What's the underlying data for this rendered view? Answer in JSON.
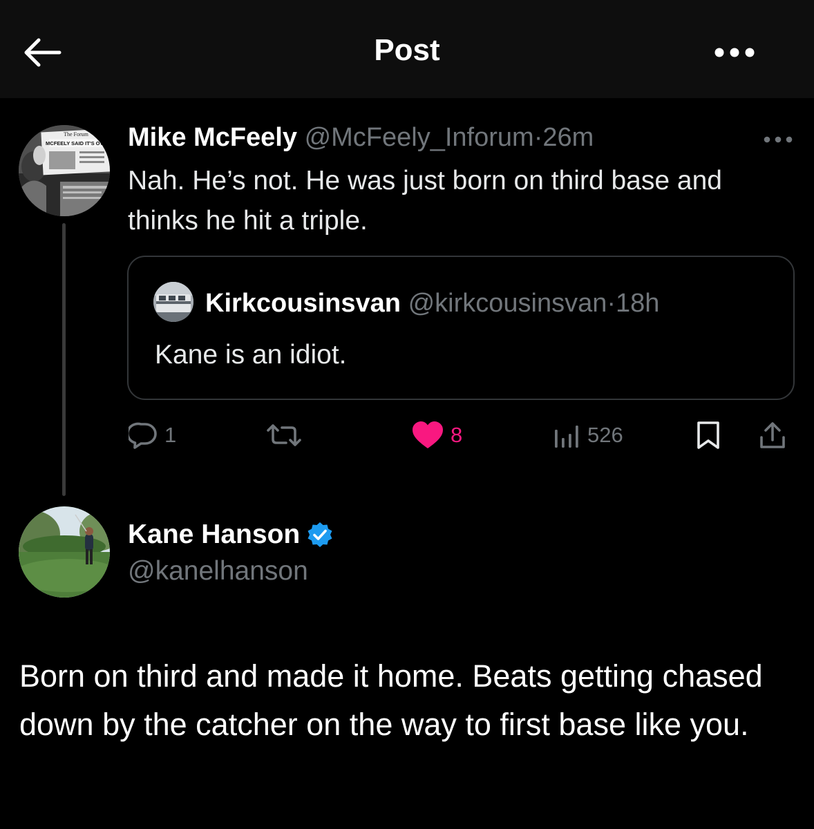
{
  "header": {
    "title": "Post",
    "back_icon": "arrow-left-icon",
    "more_icon": "more-horizontal-icon"
  },
  "parent_tweet": {
    "author_name": "Mike McFeely",
    "handle": "@McFeely_Inforum",
    "separator": "·",
    "time": "26m",
    "text": "Nah. He’s not. He was just born on third base and thinks he hit a triple.",
    "avatar_newspaper_title": "The Forum",
    "avatar_headline": "MCFEELY SAID IT'S OVER",
    "quoted_tweet": {
      "author_name": "Kirkcousinsvan",
      "handle": "@kirkcousinsvan",
      "separator": "·",
      "time": "18h",
      "text": "Kane is an idiot."
    },
    "actions": {
      "replies": "1",
      "retweets": "",
      "likes": "8",
      "views": "526"
    }
  },
  "reply_tweet": {
    "author_name": "Kane Hanson",
    "handle": "@kanelhanson",
    "verified": true,
    "text": "Born on third and made it home. Beats getting chased down by the catcher on the way to first base like you."
  },
  "colors": {
    "background": "#000000",
    "header_background": "#0e0e0e",
    "muted_text": "#71767b",
    "like_pink": "#f91880",
    "verified_blue": "#1d9bf0",
    "border": "#333639"
  }
}
